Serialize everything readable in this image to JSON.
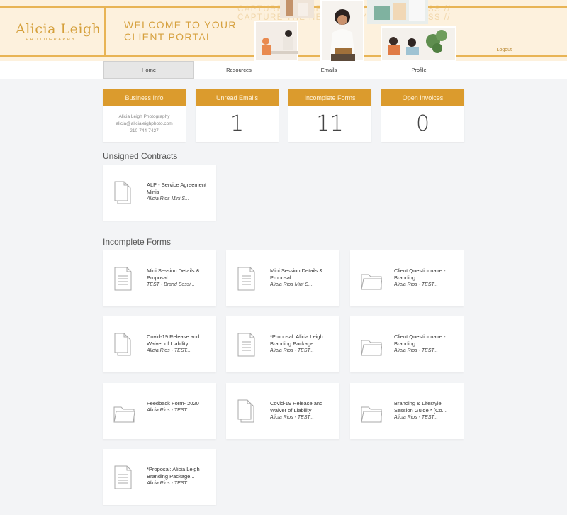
{
  "header": {
    "brand_name": "Alicia Leigh",
    "brand_tagline": "PHOTOGRAPHY",
    "welcome_line1": "WELCOME TO YOUR",
    "welcome_line2": "CLIENT PORTAL",
    "logout_label": "Logout",
    "background_words": "CAPTURE THE HEART OF YOUR BUSINESS // CAPTURE THE HEART OF YOUR BUSINESS //"
  },
  "colors": {
    "accent": "#db9b2d",
    "header_bg": "#fdf1dd",
    "page_bg": "#f3f4f6"
  },
  "nav": {
    "tabs": [
      {
        "label": "Home",
        "active": true
      },
      {
        "label": "Resources",
        "active": false
      },
      {
        "label": "Emails",
        "active": false
      },
      {
        "label": "Profile",
        "active": false
      }
    ]
  },
  "stats": {
    "business": {
      "title": "Business Info",
      "name": "Alicia Leigh Photography",
      "email": "alicia@alicialeighphoto.com",
      "phone": "210-744-7427"
    },
    "unread": {
      "title": "Unread Emails",
      "value": "1"
    },
    "forms": {
      "title": "Incomplete Forms",
      "value": "11"
    },
    "invoices": {
      "title": "Open Invoices",
      "value": "0"
    }
  },
  "unsigned_contracts": {
    "title": "Unsigned Contracts",
    "items": [
      {
        "title": "ALP - Service Agreement Minis",
        "sub": "Alicia Rios Mini S...",
        "icon": "documents-icon"
      }
    ]
  },
  "incomplete_forms": {
    "title": "Incomplete Forms",
    "items": [
      {
        "title": "Mini Session Details & Proposal",
        "sub": "TEST - Brand Sessi...",
        "icon": "document-icon"
      },
      {
        "title": "Mini Session Details & Proposal",
        "sub": "Alicia Rios Mini S...",
        "icon": "document-icon"
      },
      {
        "title": "Client Questionnaire - Branding",
        "sub": "Alicia Rios - TEST...",
        "icon": "folder-icon"
      },
      {
        "title": "Covid-19 Release and Waiver of Liability",
        "sub": "Alicia Rios - TEST...",
        "icon": "documents-icon"
      },
      {
        "title": "*Proposal: Alicia Leigh Branding Package...",
        "sub": "Alicia Rios - TEST...",
        "icon": "document-icon"
      },
      {
        "title": "Client Questionnaire - Branding",
        "sub": "Alicia Rios - TEST...",
        "icon": "folder-icon"
      },
      {
        "title": "Feedback Form- 2020",
        "sub": "Alicia Rios - TEST...",
        "icon": "folder-icon"
      },
      {
        "title": "Covid-19 Release and Waiver of Liability",
        "sub": "Alicia Rios - TEST...",
        "icon": "documents-icon"
      },
      {
        "title": "Branding & Lifestyle Session Guide * [Co...",
        "sub": "Alicia Rios - TEST...",
        "icon": "folder-icon"
      },
      {
        "title": "*Proposal: Alicia Leigh Branding Package...",
        "sub": "Alicia Rios - TEST...",
        "icon": "document-icon"
      }
    ]
  }
}
